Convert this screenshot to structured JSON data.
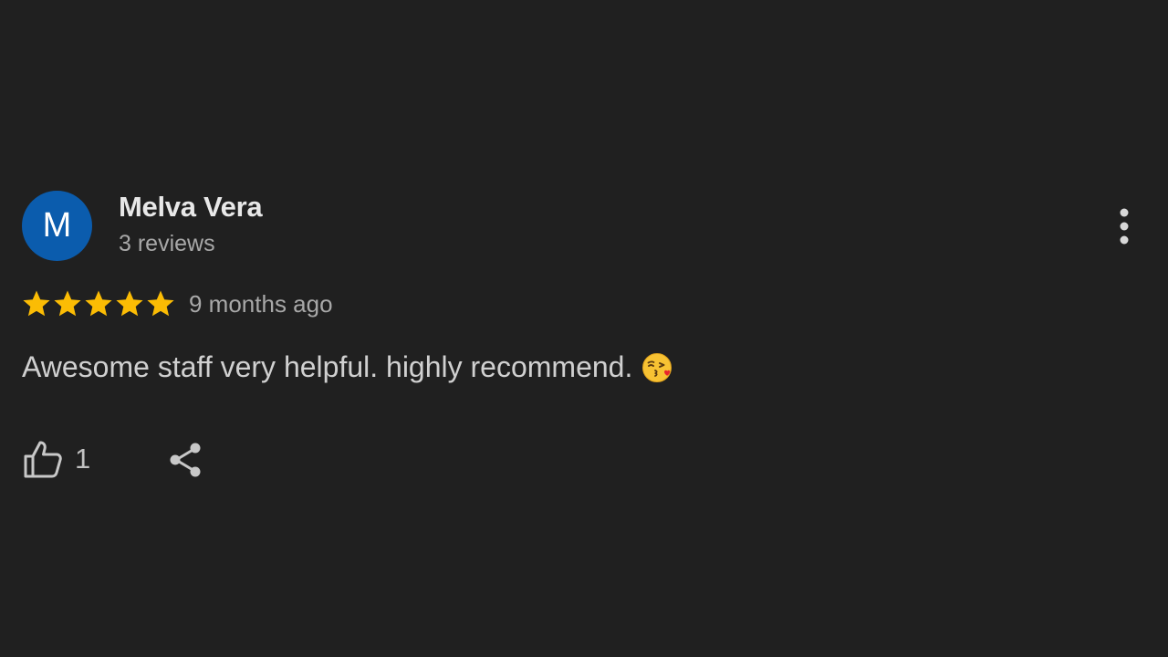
{
  "review": {
    "author": {
      "initial": "M",
      "name": "Melva Vera",
      "review_count": "3 reviews",
      "avatar_color": "#0b5cad"
    },
    "rating": {
      "stars": 5,
      "max_stars": 5,
      "star_color": "#fbbc04"
    },
    "time_ago": "9 months ago",
    "text": "Awesome staff very helpful. highly recommend.",
    "emoji": "kissing-face-with-heart-emoji",
    "actions": {
      "like_icon": "thumbs-up-icon",
      "like_count": "1",
      "share_icon": "share-icon",
      "more_icon": "more-vertical-icon"
    }
  },
  "theme": {
    "background": "#202020"
  }
}
